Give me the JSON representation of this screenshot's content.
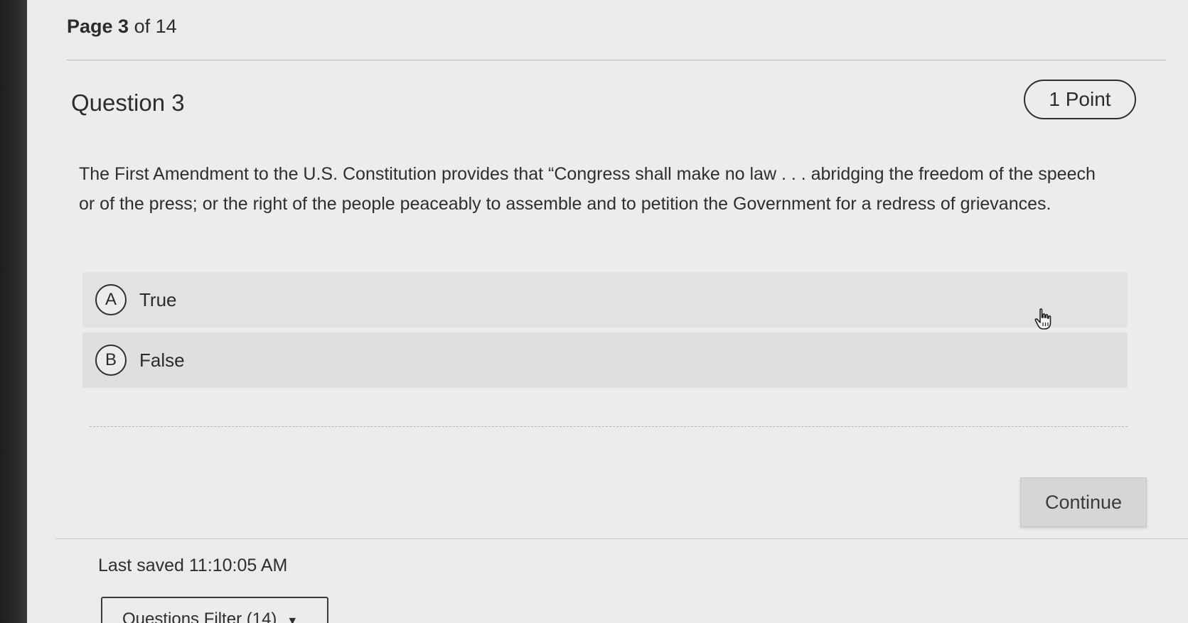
{
  "page": {
    "label_bold": "Page 3",
    "label_rest": " of 14"
  },
  "question": {
    "title": "Question 3",
    "points": "1 Point",
    "text": "The First Amendment to the U.S. Constitution provides that “Congress shall make no law . . . abridging the freedom of the speech or of the press; or the right of the people peaceably to assemble and to petition the Government for a redress of grievances."
  },
  "options": [
    {
      "letter": "A",
      "label": "True"
    },
    {
      "letter": "B",
      "label": "False"
    }
  ],
  "actions": {
    "continue_label": "Continue"
  },
  "footer": {
    "last_saved": "Last saved 11:10:05 AM",
    "filter_label": "Questions Filter (14)"
  },
  "icons": {
    "cursor": "hand-pointer-icon",
    "caret": "caret-down-icon"
  }
}
